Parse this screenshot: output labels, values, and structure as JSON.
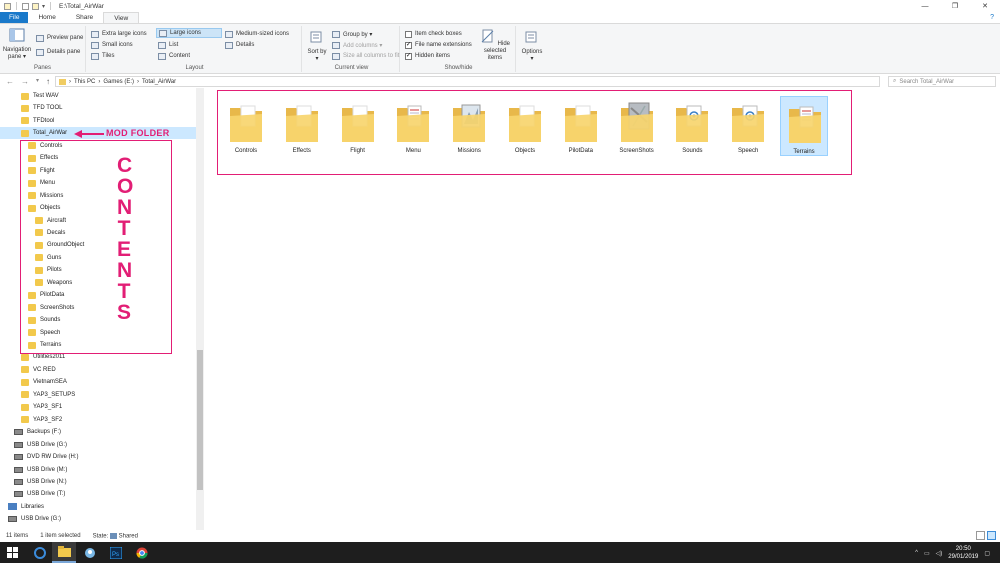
{
  "window": {
    "title": "E:\\Total_AirWar",
    "controls": [
      "—",
      "❐",
      "✕"
    ],
    "help": "?"
  },
  "tabs": [
    "File",
    "Home",
    "Share",
    "View"
  ],
  "ribbon": {
    "panes": {
      "name": "Panes",
      "navigation_pane": "Navigation pane ▾",
      "preview_pane": "Preview pane",
      "details_pane": "Details pane"
    },
    "layout": {
      "name": "Layout",
      "options": [
        "Extra large icons",
        "Large icons",
        "Medium-sized icons",
        "Small icons",
        "List",
        "Details",
        "Tiles",
        "Content"
      ],
      "selected": "Large icons"
    },
    "current_view": {
      "name": "Current view",
      "sort_by": "Sort by ▾",
      "group_by": "Group by ▾",
      "add_columns": "Add columns ▾",
      "size_columns": "Size all columns to fit"
    },
    "show_hide": {
      "name": "Show/hide",
      "item_check_boxes": "Item check boxes",
      "file_name_extensions": "File name extensions",
      "hidden_items": "Hidden items",
      "hide_selected": "Hide selected items"
    },
    "options": "Options ▾"
  },
  "address": {
    "path": [
      "This PC",
      "Games (E:)",
      "Total_AirWar"
    ],
    "search_placeholder": "Search Total_AirWar"
  },
  "nav_tree": [
    {
      "label": "Test WAV",
      "type": "folder",
      "indent": 1
    },
    {
      "label": "TFD TOOL",
      "type": "folder",
      "indent": 1
    },
    {
      "label": "TFDtool",
      "type": "folder",
      "indent": 1
    },
    {
      "label": "Total_AirWar",
      "type": "folder",
      "indent": 1,
      "selected": true
    },
    {
      "label": "Controls",
      "type": "folder",
      "indent": 2
    },
    {
      "label": "Effects",
      "type": "folder",
      "indent": 2
    },
    {
      "label": "Flight",
      "type": "folder",
      "indent": 2
    },
    {
      "label": "Menu",
      "type": "folder",
      "indent": 2
    },
    {
      "label": "Missions",
      "type": "folder",
      "indent": 2
    },
    {
      "label": "Objects",
      "type": "folder",
      "indent": 2
    },
    {
      "label": "Aircraft",
      "type": "folder",
      "indent": 3
    },
    {
      "label": "Decals",
      "type": "folder",
      "indent": 3
    },
    {
      "label": "GroundObject",
      "type": "folder",
      "indent": 3
    },
    {
      "label": "Guns",
      "type": "folder",
      "indent": 3
    },
    {
      "label": "Pilots",
      "type": "folder",
      "indent": 3
    },
    {
      "label": "Weapons",
      "type": "folder",
      "indent": 3
    },
    {
      "label": "PilotData",
      "type": "folder",
      "indent": 2
    },
    {
      "label": "ScreenShots",
      "type": "folder",
      "indent": 2
    },
    {
      "label": "Sounds",
      "type": "folder",
      "indent": 2
    },
    {
      "label": "Speech",
      "type": "folder",
      "indent": 2
    },
    {
      "label": "Terrains",
      "type": "folder",
      "indent": 2
    },
    {
      "label": "Utilities2011",
      "type": "folder",
      "indent": 1
    },
    {
      "label": "VC RED",
      "type": "folder",
      "indent": 1
    },
    {
      "label": "VietnamSEA",
      "type": "folder",
      "indent": 1
    },
    {
      "label": "YAP3_SETUPS",
      "type": "folder",
      "indent": 1
    },
    {
      "label": "YAP3_SF1",
      "type": "folder",
      "indent": 1
    },
    {
      "label": "YAP3_SF2",
      "type": "folder",
      "indent": 1
    },
    {
      "label": "Backups (F:)",
      "type": "drive",
      "indent": 0
    },
    {
      "label": "USB Drive (G:)",
      "type": "drive",
      "indent": 0
    },
    {
      "label": "DVD RW Drive (H:)",
      "type": "drive",
      "indent": 0
    },
    {
      "label": "USB Drive (M:)",
      "type": "drive",
      "indent": 0
    },
    {
      "label": "USB Drive (N:)",
      "type": "drive",
      "indent": 0
    },
    {
      "label": "USB Drive (T:)",
      "type": "drive",
      "indent": 0
    },
    {
      "label": "Libraries",
      "type": "library",
      "indent": -1
    },
    {
      "label": "USB Drive (G:)",
      "type": "drive",
      "indent": -1
    }
  ],
  "annotations": {
    "mod_folder": "MOD FOLDER",
    "contents": [
      "C",
      "O",
      "N",
      "T",
      "E",
      "N",
      "T",
      "S"
    ],
    "color": "#e21e75"
  },
  "folders": [
    {
      "name": "Controls",
      "preview": "none"
    },
    {
      "name": "Effects",
      "preview": "none"
    },
    {
      "name": "Flight",
      "preview": "none"
    },
    {
      "name": "Menu",
      "preview": "doc"
    },
    {
      "name": "Missions",
      "preview": "image"
    },
    {
      "name": "Objects",
      "preview": "none"
    },
    {
      "name": "PilotData",
      "preview": "none"
    },
    {
      "name": "ScreenShots",
      "preview": "photo"
    },
    {
      "name": "Sounds",
      "preview": "audio"
    },
    {
      "name": "Speech",
      "preview": "audio"
    },
    {
      "name": "Terrains",
      "preview": "doc",
      "selected": true
    }
  ],
  "status": {
    "items": "11 items",
    "selected": "1 item selected",
    "state": "State:",
    "shared": "Shared"
  },
  "taskbar": {
    "time": "20:50",
    "date": "29/01/2019",
    "apps": [
      "start-icon",
      "edge-icon",
      "file-explorer-icon",
      "user-app-icon",
      "photoshop-icon",
      "chrome-icon"
    ]
  }
}
